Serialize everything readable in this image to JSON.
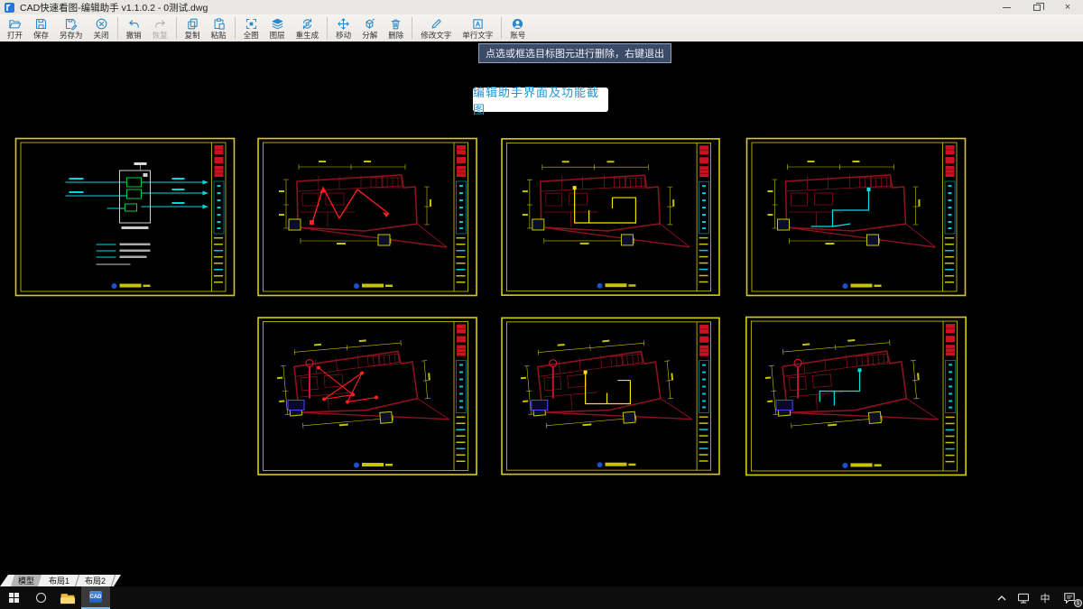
{
  "window": {
    "title": "CAD快速看图-编辑助手 v1.1.0.2 - 0测试.dwg"
  },
  "toolbar": {
    "icon_color": "#2a8ac8",
    "disabled_color": "#b2b2b2",
    "buttons": [
      {
        "label": "打开",
        "icon": "open-icon"
      },
      {
        "label": "保存",
        "icon": "save-icon"
      },
      {
        "label": "另存为",
        "icon": "save-as-icon"
      },
      {
        "label": "关闭",
        "icon": "close-file-icon"
      },
      {
        "label": "撤销",
        "icon": "undo-icon"
      },
      {
        "label": "恢复",
        "icon": "redo-icon",
        "disabled": true
      },
      {
        "label": "复制",
        "icon": "copy-icon"
      },
      {
        "label": "粘贴",
        "icon": "paste-icon"
      },
      {
        "label": "全图",
        "icon": "full-view-icon"
      },
      {
        "label": "图层",
        "icon": "layers-icon"
      },
      {
        "label": "重生成",
        "icon": "regenerate-icon"
      },
      {
        "label": "移动",
        "icon": "move-icon"
      },
      {
        "label": "分解",
        "icon": "explode-icon"
      },
      {
        "label": "删除",
        "icon": "delete-icon"
      },
      {
        "label": "修改文字",
        "icon": "edit-text-icon"
      },
      {
        "label": "单行文字",
        "icon": "single-line-text-icon"
      },
      {
        "label": "账号",
        "icon": "account-icon"
      }
    ]
  },
  "tooltip": {
    "text": "点选或框选目标图元进行删除，右键退出"
  },
  "canvas": {
    "background": "#000000",
    "label": "编辑助手界面及功能截图",
    "label_color": "#2196d3",
    "sheet_colors": {
      "frame": "#d6cf00",
      "wall": "#8c1220",
      "dim": "#c8c400",
      "title_red": "#cf1020",
      "title_cyan": "#00c8e0"
    },
    "thumbnails": [
      {
        "name": "sheet-schematic",
        "variant": "schematic",
        "accent": "#00d8d8"
      },
      {
        "name": "sheet-plan-red",
        "variant": "plan",
        "accent": "#ff2020"
      },
      {
        "name": "sheet-plan-yellow",
        "variant": "plan",
        "accent": "#ffe000"
      },
      {
        "name": "sheet-plan-cyan",
        "variant": "plan",
        "accent": "#00e0e0"
      },
      {
        "name": "sheet-plan2-red",
        "variant": "plan2",
        "accent": "#ff2020"
      },
      {
        "name": "sheet-plan2-yellow",
        "variant": "plan2",
        "accent": "#ffe000"
      },
      {
        "name": "sheet-plan2-cyan",
        "variant": "plan2",
        "accent": "#00e0e0"
      }
    ]
  },
  "tabs": {
    "items": [
      {
        "label": "模型",
        "active": true
      },
      {
        "label": "布局1",
        "active": false
      },
      {
        "label": "布局2",
        "active": false
      }
    ]
  },
  "taskbar": {
    "app_label": "CAD",
    "ime_indicator": "中",
    "notification_badge": "1"
  }
}
